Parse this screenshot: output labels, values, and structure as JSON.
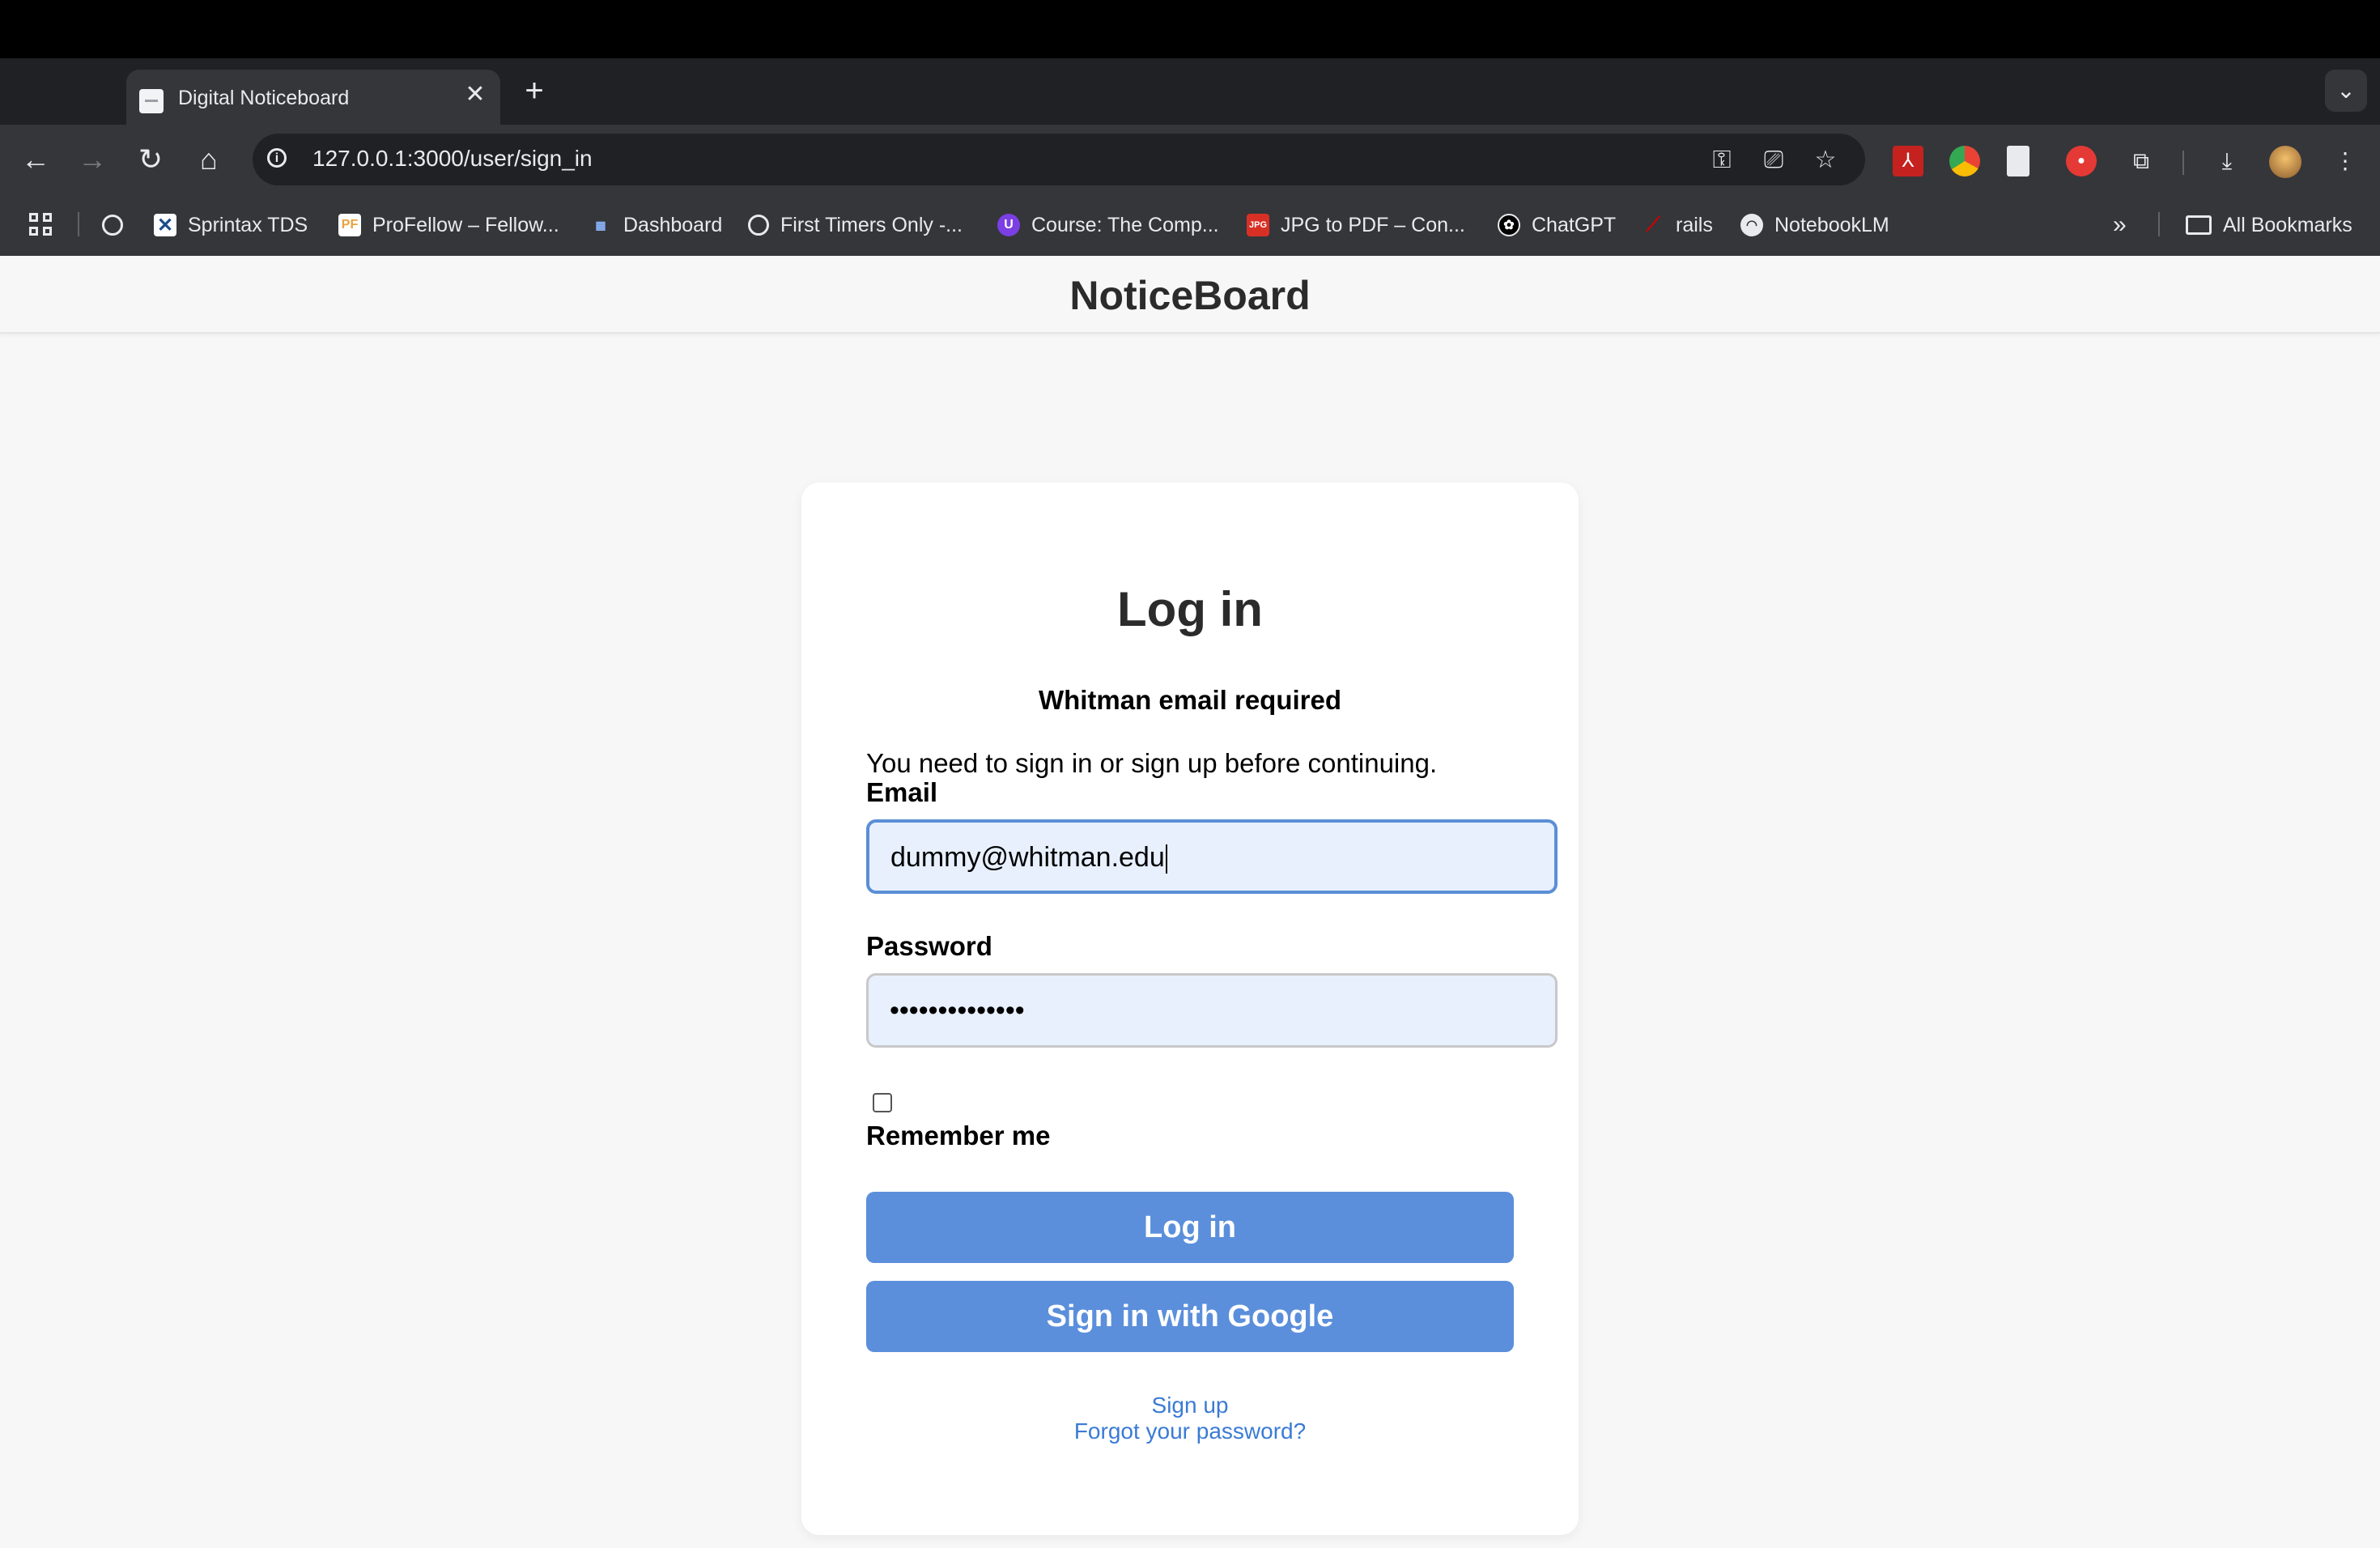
{
  "browser": {
    "tab": {
      "title": "Digital Noticeboard",
      "close_glyph": "✕"
    },
    "new_tab_glyph": "+",
    "tab_search_glyph": "⌄",
    "url": "127.0.0.1:3000/user/sign_in",
    "nav": {
      "back": "←",
      "forward": "→",
      "reload": "↻",
      "home": "⌂"
    },
    "omnibox_icons": [
      "key-icon",
      "install-icon",
      "star-icon"
    ],
    "bookmarks": [
      {
        "label": "Sprintax TDS",
        "icon": "sprintax-icon"
      },
      {
        "label": "ProFellow – Fellow...",
        "icon": "profellow-icon"
      },
      {
        "label": "Dashboard",
        "icon": "dashboard-icon"
      },
      {
        "label": "First Timers Only -...",
        "icon": "globe-icon"
      },
      {
        "label": "Course: The Comp...",
        "icon": "course-icon"
      },
      {
        "label": "JPG to PDF – Con...",
        "icon": "jpg-pdf-icon"
      },
      {
        "label": "ChatGPT",
        "icon": "chatgpt-icon"
      },
      {
        "label": "rails",
        "icon": "rails-icon"
      },
      {
        "label": "NotebookLM",
        "icon": "notebooklm-icon"
      }
    ],
    "bookmarks_overflow": "»",
    "all_bookmarks": "All Bookmarks"
  },
  "header": {
    "brand": "NoticeBoard"
  },
  "login": {
    "title": "Log in",
    "notice": "Whitman email required",
    "alert": "You need to sign in or sign up before continuing.",
    "email_label": "Email",
    "email_value": "dummy@whitman.edu",
    "password_label": "Password",
    "password_value": "••••••••••••••",
    "remember_label": "Remember me",
    "remember_checked": false,
    "submit_label": "Log in",
    "google_label": "Sign in with Google",
    "signup_link": "Sign up",
    "forgot_link": "Forgot your password?"
  },
  "colors": {
    "accent": "#5b8fdb",
    "link": "#3a7bd5",
    "input_bg": "#e8f0fe",
    "chrome_dark": "#202124",
    "chrome_toolbar": "#35363a"
  }
}
